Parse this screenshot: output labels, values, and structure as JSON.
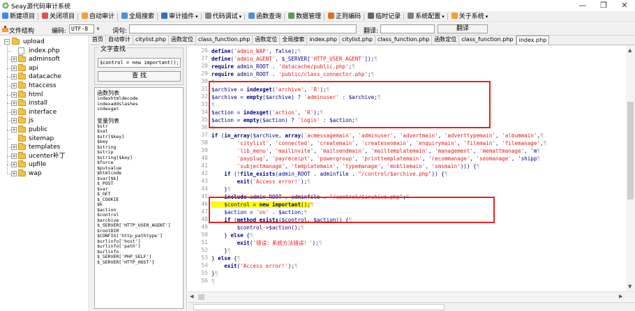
{
  "window": {
    "title": "Seay源代码审计系统",
    "minimize": "—",
    "maximize": "❐",
    "close": "✕"
  },
  "menu": [
    {
      "label": "新建项目",
      "icon": "new-project-icon",
      "color": "#3a8ee6",
      "arrow": false
    },
    {
      "label": "关闭项目",
      "icon": "close-project-icon",
      "color": "#e05050",
      "arrow": false
    },
    {
      "label": "自动审计",
      "icon": "auto-audit-icon",
      "color": "#f0a030",
      "arrow": false
    },
    {
      "label": "全局搜索",
      "icon": "global-search-icon",
      "color": "#4a90d9",
      "arrow": false
    },
    {
      "label": "审计插件",
      "icon": "audit-plugin-icon",
      "color": "#3070c0",
      "arrow": true
    },
    {
      "label": "代码调试",
      "icon": "code-debug-icon",
      "color": "#888888",
      "arrow": true
    },
    {
      "label": "函数查询",
      "icon": "function-query-icon",
      "color": "#4a90d9",
      "arrow": false
    },
    {
      "label": "数据管理",
      "icon": "data-manage-icon",
      "color": "#5a9a5a",
      "arrow": false
    },
    {
      "label": "正则编码",
      "icon": "regex-encode-icon",
      "color": "#e07020",
      "arrow": false
    },
    {
      "label": "临时记录",
      "icon": "temp-record-icon",
      "color": "#666666",
      "arrow": false
    },
    {
      "label": "系统配置",
      "icon": "system-config-icon",
      "color": "#808080",
      "arrow": true
    },
    {
      "label": "关于系统",
      "icon": "about-icon",
      "color": "#f0a030",
      "arrow": true
    }
  ],
  "toolbar": {
    "file_structure": "文件结构",
    "encoding_label": "编码:",
    "encoding_value": "UTF-8",
    "word_label": "词句:",
    "word_value": "",
    "translate_label": "翻译:",
    "translate_value": "",
    "translate_button": "翻译"
  },
  "tree": [
    {
      "label": "upload",
      "level": 0,
      "type": "folder",
      "expander": "−"
    },
    {
      "label": "index.php",
      "level": 1,
      "type": "file",
      "expander": ""
    },
    {
      "label": "adminsoft",
      "level": 1,
      "type": "folder",
      "expander": "+"
    },
    {
      "label": "api",
      "level": 1,
      "type": "folder",
      "expander": "+"
    },
    {
      "label": "datacache",
      "level": 1,
      "type": "folder",
      "expander": "+"
    },
    {
      "label": "htaccess",
      "level": 1,
      "type": "folder",
      "expander": "+"
    },
    {
      "label": "html",
      "level": 1,
      "type": "folder",
      "expander": "+"
    },
    {
      "label": "install",
      "level": 1,
      "type": "folder",
      "expander": "+"
    },
    {
      "label": "interface",
      "level": 1,
      "type": "folder",
      "expander": "+"
    },
    {
      "label": "js",
      "level": 1,
      "type": "folder",
      "expander": "+"
    },
    {
      "label": "public",
      "level": 1,
      "type": "folder",
      "expander": "+"
    },
    {
      "label": "sitemap",
      "level": 1,
      "type": "folder",
      "expander": ""
    },
    {
      "label": "templates",
      "level": 1,
      "type": "folder",
      "expander": "+"
    },
    {
      "label": "ucenter补丁",
      "level": 1,
      "type": "folder",
      "expander": "+"
    },
    {
      "label": "upfile",
      "level": 1,
      "type": "folder",
      "expander": "+"
    },
    {
      "label": "wap",
      "level": 1,
      "type": "folder",
      "expander": "+"
    }
  ],
  "tabs": [
    {
      "label": "首页",
      "icon": false,
      "active": false
    },
    {
      "label": "自动审计",
      "icon": false,
      "active": false
    },
    {
      "label": "citylist.php",
      "icon": false,
      "active": false
    },
    {
      "label": "函数定位",
      "icon": false,
      "active": false
    },
    {
      "label": "class_function.php",
      "icon": false,
      "active": false
    },
    {
      "label": "函数定位",
      "icon": false,
      "active": false
    },
    {
      "label": "全局搜索",
      "icon": false,
      "active": false
    },
    {
      "label": "index.php",
      "icon": false,
      "active": false
    },
    {
      "label": "citylist.php",
      "icon": false,
      "active": false
    },
    {
      "label": "class_function.php",
      "icon": false,
      "active": false
    },
    {
      "label": "函数定位",
      "icon": false,
      "active": false
    },
    {
      "label": "class_function.php",
      "icon": false,
      "active": false
    },
    {
      "label": "index.php",
      "icon": false,
      "active": true
    }
  ],
  "fnpanel": {
    "group_title": "文字查找",
    "search_value": "$control = new important();",
    "search_button": "查 找",
    "functions_head": "函数列表",
    "functions": [
      "indexhtmldecode",
      "indexaddslashes",
      "indexget"
    ],
    "vars_head": "变量列表",
    "vars": [
      "$str",
      "$val",
      "$str[$key]",
      "$key",
      "$string",
      "$strip",
      "$string[$key]",
      "$force",
      "$putvalue",
      "$htmlcode",
      "$var[$k]",
      "$_POST",
      "$var",
      "$_GET",
      "$_COOKIE",
      "$k",
      "$action",
      "$control",
      "$archive",
      "$_SERVER['HTTP_USER_AGENT']",
      "$rootDIR",
      "$CONFIG['http_pathtype']",
      "$urlinfo['host']",
      "$urlinfo['path']",
      "$urlinfo",
      "$_SERVER['PHP_SELF']",
      "$_SERVER['HTTP_HOST']"
    ]
  },
  "code": {
    "lines": [
      {
        "n": "26",
        "text": "define('admin_WAP', false);"
      },
      {
        "n": "27",
        "text": "define('admin_AGENT', $_SERVER['HTTP_USER_AGENT']);"
      },
      {
        "n": "28",
        "text": "require admin_ROOT . 'datacache/public.php';"
      },
      {
        "n": "29",
        "text": "require admin_ROOT . 'public/class_connector.php';"
      },
      {
        "n": "30",
        "text": ""
      },
      {
        "n": "31",
        "text": "$archive = indexget('archive', 'R');"
      },
      {
        "n": "32",
        "text": "$archive = empty($archive) ? 'adminuser' : $archive;"
      },
      {
        "n": "33",
        "text": ""
      },
      {
        "n": "34",
        "text": "$action = indexget('action', 'R');"
      },
      {
        "n": "35",
        "text": "$action = empty($action) ? 'login' : $action;"
      },
      {
        "n": "36",
        "text": ""
      },
      {
        "n": "37",
        "text": "if (in_array($archive, array('acmessagemain', 'adminuser', 'advertmain', 'adverttypemain', 'albummain',"
      },
      {
        "n": "38",
        "text": "        'citylist', 'connected', 'createmain', 'createseomain', 'enquirymain', 'filemain', 'filemanage',"
      },
      {
        "n": "39",
        "text": "        'lib_menu', 'mailinvite', 'mailsendmain', 'mailtemplatemain', 'management', 'memattmanage', 'm"
      },
      {
        "n": "40",
        "text": "        'payplug', 'payreceipt', 'powergroup', 'printtemplatemain', 'recommanage', 'seomanage', 'shipp"
      },
      {
        "n": "41",
        "text": "        'subjectmanage', 'templatemain', 'typemanage', 'mobliemain', 'smsmain'))) {"
      },
      {
        "n": "42",
        "text": "    if (!file_exists(admin_ROOT . adminfile . \"/control/$archive.php\")) {"
      },
      {
        "n": "43",
        "text": "        exit('Access error!');"
      },
      {
        "n": "44",
        "text": "    }"
      },
      {
        "n": "45",
        "text": "    include admin_ROOT . adminfile . \"/control/$archive.php\";"
      },
      {
        "n": "46",
        "text": "    $control = new important();"
      },
      {
        "n": "47",
        "text": "    $action = 'on' . $action;"
      },
      {
        "n": "48",
        "text": "    if (method_exists($control, $action)) {"
      },
      {
        "n": "49",
        "text": "        $control->$action();"
      },
      {
        "n": "50",
        "text": "    } else {"
      },
      {
        "n": "51",
        "text": "        exit('错误：系统方法错误！');"
      },
      {
        "n": "52",
        "text": "    }"
      },
      {
        "n": "53",
        "text": "} else {"
      },
      {
        "n": "54",
        "text": "    exit('Access error!');"
      },
      {
        "n": "55",
        "text": "}"
      },
      {
        "n": "56",
        "text": ""
      }
    ],
    "highlight_line": "46"
  },
  "colors": {
    "highlight": "#ffff00",
    "annotation_box": "#e8201e",
    "code_text": "#000080",
    "string": "#e02020"
  }
}
